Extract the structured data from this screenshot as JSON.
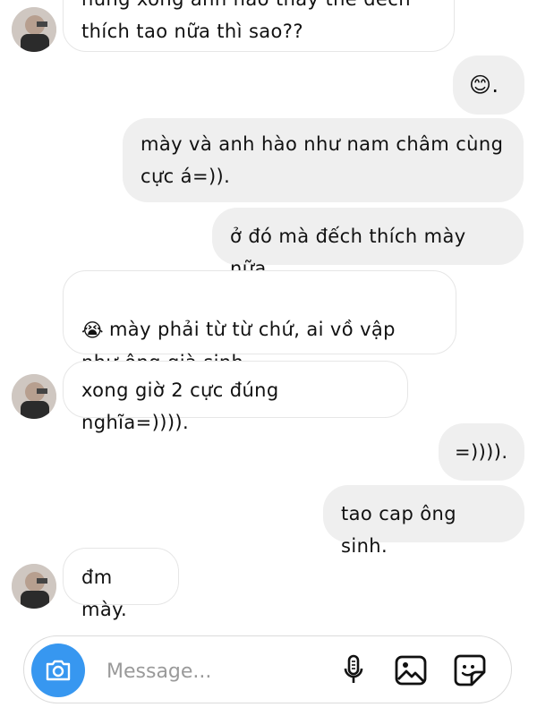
{
  "messages": [
    {
      "side": "in",
      "text": "hứng xong anh hào thấy thế đếch\nthích tao nữa thì sao??"
    },
    {
      "side": "out",
      "text": "😊."
    },
    {
      "side": "out",
      "text": "mày và anh hào như nam châm cùng\ncực á=))."
    },
    {
      "side": "out",
      "text": "ở đó mà đếch thích mày nữa."
    },
    {
      "side": "in",
      "emoji": "😭",
      "text": "mày phải từ từ chứ, ai vồ vập\nnhư ông già sinh."
    },
    {
      "side": "in",
      "text": "xong giờ 2 cực đúng nghĩa=))))."
    },
    {
      "side": "out",
      "text": "=))))."
    },
    {
      "side": "out",
      "text": "tao cap ông sinh."
    },
    {
      "side": "in",
      "text": "đm mày."
    }
  ],
  "composer": {
    "placeholder": "Message...",
    "icons": [
      "camera-icon",
      "microphone-icon",
      "gallery-icon",
      "sticker-icon"
    ]
  },
  "colors": {
    "accent": "#3797f0",
    "outgoing_bubble": "#efefef",
    "incoming_border": "#e6e6e6"
  }
}
